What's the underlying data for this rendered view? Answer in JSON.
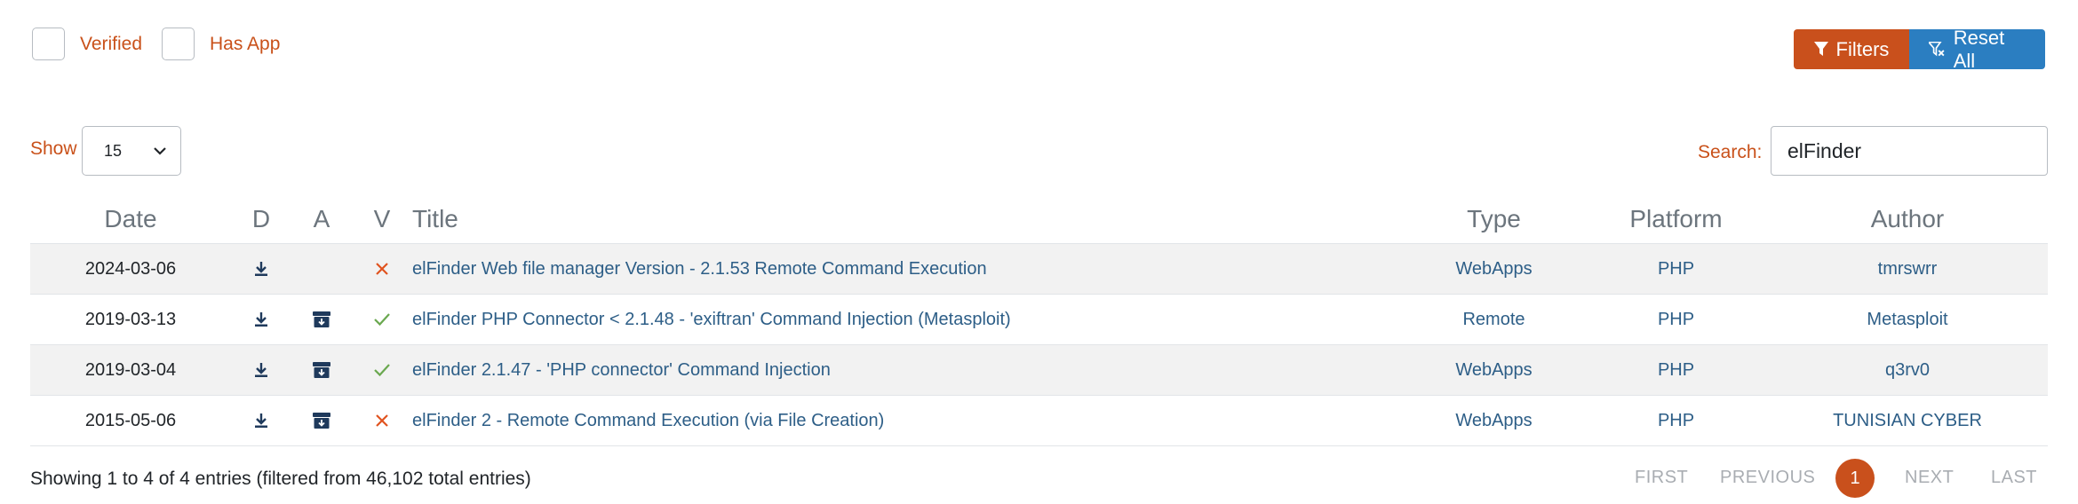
{
  "filters": {
    "verified_label": "Verified",
    "has_app_label": "Has App",
    "filters_button": "Filters",
    "reset_button": "Reset All"
  },
  "length": {
    "show_label": "Show",
    "selected": "15"
  },
  "search": {
    "label": "Search:",
    "value": "elFinder"
  },
  "table": {
    "headers": {
      "date": "Date",
      "download": "D",
      "app": "A",
      "verified": "V",
      "title": "Title",
      "type": "Type",
      "platform": "Platform",
      "author": "Author"
    },
    "rows": [
      {
        "date": "2024-03-06",
        "has_download": true,
        "has_app": false,
        "verified": false,
        "title": "elFinder Web file manager Version - 2.1.53 Remote Command Execution",
        "type": "WebApps",
        "platform": "PHP",
        "author": "tmrswrr"
      },
      {
        "date": "2019-03-13",
        "has_download": true,
        "has_app": true,
        "verified": true,
        "title": "elFinder PHP Connector < 2.1.48 - 'exiftran' Command Injection (Metasploit)",
        "type": "Remote",
        "platform": "PHP",
        "author": "Metasploit"
      },
      {
        "date": "2019-03-04",
        "has_download": true,
        "has_app": true,
        "verified": true,
        "title": "elFinder 2.1.47 - 'PHP connector' Command Injection",
        "type": "WebApps",
        "platform": "PHP",
        "author": "q3rv0"
      },
      {
        "date": "2015-05-06",
        "has_download": true,
        "has_app": true,
        "verified": false,
        "title": "elFinder 2 - Remote Command Execution (via File Creation)",
        "type": "WebApps",
        "platform": "PHP",
        "author": "TUNISIAN CYBER"
      }
    ]
  },
  "footer": {
    "info": "Showing 1 to 4 of 4 entries (filtered from 46,102 total entries)",
    "pagination": {
      "first": "FIRST",
      "previous": "PREVIOUS",
      "current": "1",
      "next": "NEXT",
      "last": "LAST"
    }
  },
  "icons": {
    "download": "download-icon",
    "app": "archive-icon",
    "verified": "check-icon",
    "not_verified": "x-icon",
    "filter": "funnel-icon",
    "reset": "funnel-x-icon"
  },
  "colors": {
    "accent_orange": "#c9501c",
    "accent_blue": "#2b7ec1",
    "link": "#2d5e87",
    "check_green": "#6aa84f",
    "x_red": "#e0531f",
    "icon_dark": "#1f3a5c"
  }
}
